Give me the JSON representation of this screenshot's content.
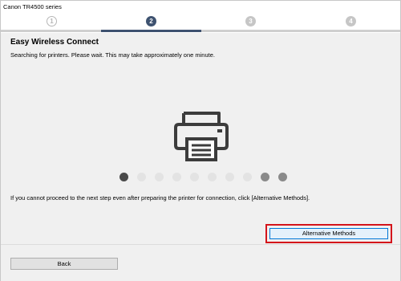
{
  "window": {
    "title": "Canon TR4500 series"
  },
  "steps": [
    {
      "label": "1",
      "state": "done"
    },
    {
      "label": "2",
      "state": "active"
    },
    {
      "label": "3",
      "state": "pending"
    },
    {
      "label": "4",
      "state": "pending"
    }
  ],
  "main": {
    "heading": "Easy Wireless Connect",
    "subtext": "Searching for printers. Please wait. This may take approximately one minute.",
    "illustration_icon": "printer-icon",
    "progress_dots": {
      "count": 10,
      "current": 1
    },
    "info_text": "If you cannot proceed to the next step even after preparing the printer for connection, click [Alternative Methods].",
    "alternative_button_label": "Alternative Methods"
  },
  "footer": {
    "back_label": "Back"
  },
  "colors": {
    "active_step": "#3e5270",
    "highlight_border": "#d4141b",
    "focused_button_border": "#0078d7"
  }
}
